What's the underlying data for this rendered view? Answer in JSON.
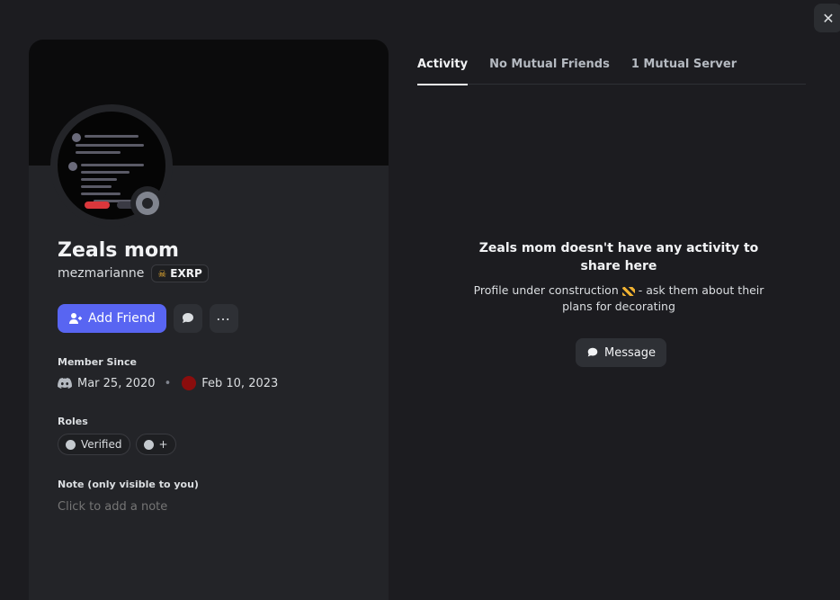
{
  "close": {
    "label": "✕"
  },
  "profile": {
    "display_name": "Zeals mom",
    "username": "mezmarianne",
    "server_tag": "EXRP",
    "actions": {
      "add_friend_label": "Add Friend"
    },
    "member_since": {
      "label": "Member Since",
      "discord_date": "Mar 25, 2020",
      "server_date": "Feb 10, 2023"
    },
    "roles": {
      "label": "Roles",
      "items": [
        "Verified",
        "+"
      ]
    },
    "note": {
      "label": "Note (only visible to you)",
      "placeholder": "Click to add a note"
    }
  },
  "tabs": [
    "Activity",
    "No Mutual Friends",
    "1 Mutual Server"
  ],
  "empty_state": {
    "title": "Zeals mom doesn't have any activity to share here",
    "subtitle_before": "Profile under construction",
    "subtitle_after": "- ask them about their plans for decorating",
    "message_label": "Message"
  },
  "colors": {
    "accent": "#5865f2",
    "background": "#1c1c20",
    "card": "#232428"
  }
}
